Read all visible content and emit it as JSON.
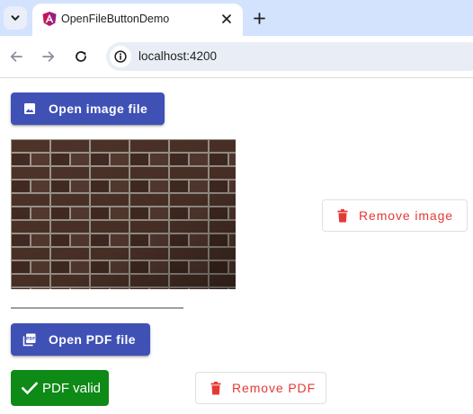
{
  "browser": {
    "tab": {
      "title": "OpenFileButtonDemo"
    },
    "address_bar": {
      "url": "localhost:4200"
    }
  },
  "page": {
    "image_section": {
      "open_button_label": "Open image file",
      "remove_button_label": "Remove image"
    },
    "pdf_section": {
      "open_button_label": "Open PDF file",
      "status_label": "PDF valid",
      "remove_button_label": "Remove PDF"
    }
  },
  "colors": {
    "primary": "#3f51b5",
    "warn": "#e53935",
    "success": "#0e8a16",
    "tabstrip": "#d3e3fd"
  },
  "icons": {
    "tab_favicon": "angular-logo-icon",
    "open_image": "image-icon",
    "remove": "trash-icon",
    "open_pdf": "pdf-icon",
    "valid": "check-icon"
  }
}
